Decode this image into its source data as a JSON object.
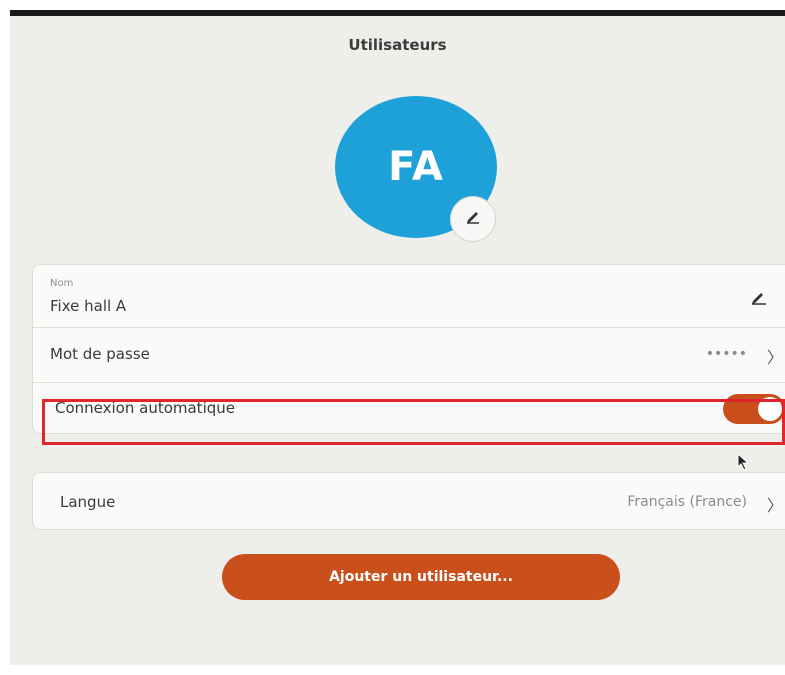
{
  "header": {
    "title": "Utilisateurs"
  },
  "avatar": {
    "initials": "FA",
    "color": "#1ea0d8",
    "edit_icon": "pencil-icon"
  },
  "account": {
    "name_label": "Nom",
    "name_value": "Fixe hall A",
    "password_label": "Mot de passe",
    "password_value": "•••••",
    "autologin_label": "Connexion automatique",
    "autologin_enabled": true
  },
  "language": {
    "label": "Langue",
    "value": "Français (France)"
  },
  "actions": {
    "add_user_label": "Ajouter un utilisateur..."
  },
  "colors": {
    "accent": "#c9501a",
    "highlight": "#e0262c"
  }
}
